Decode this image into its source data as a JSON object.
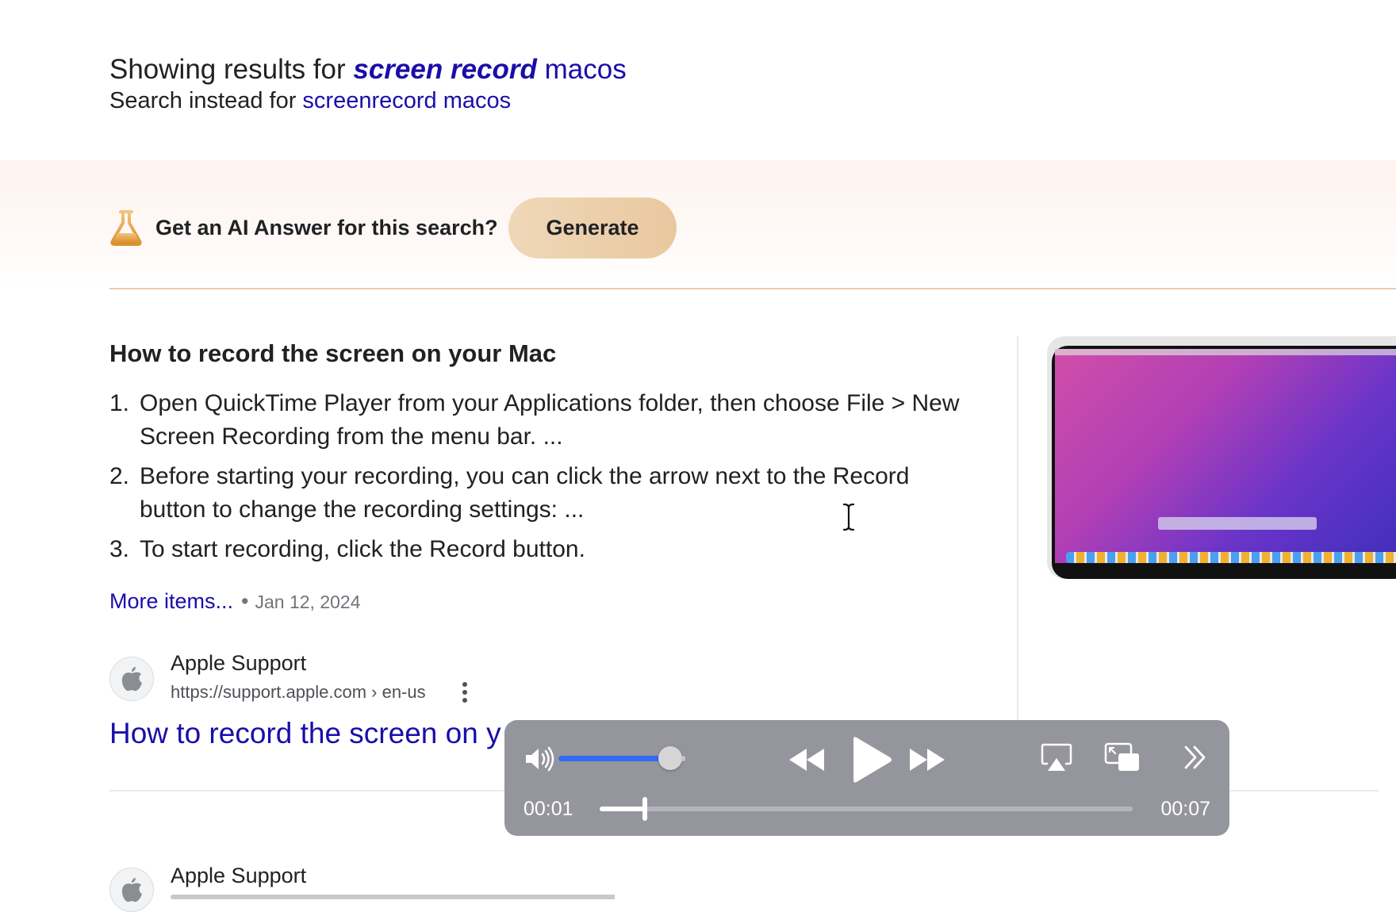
{
  "spelling": {
    "showing_prefix": "Showing results for",
    "corrected_bold": "screen record",
    "corrected_rest": "macos",
    "instead_prefix": "Search instead for",
    "instead_query": "screenrecord macos"
  },
  "ai_prompt": {
    "text": "Get an AI Answer for this search?",
    "button": "Generate",
    "icon": "flask-icon",
    "accent_color": "#e9c89f"
  },
  "snippet": {
    "title": "How to record the screen on your Mac",
    "steps": [
      {
        "num": "1.",
        "text": "Open QuickTime Player from your Applications folder, then choose File > New Screen Recording from the menu bar. ..."
      },
      {
        "num": "2.",
        "text": "Before starting your recording, you can click the arrow next to the Record button to change the recording settings: ..."
      },
      {
        "num": "3.",
        "text": "To start recording, click the Record button."
      }
    ],
    "more_link": "More items...",
    "separator": "•",
    "date": "Jan 12, 2024"
  },
  "results": [
    {
      "source": "Apple Support",
      "url": "https://support.apple.com › en-us",
      "title": "How to record the screen on y"
    },
    {
      "source": "Apple Support"
    }
  ],
  "media_hud": {
    "current_time": "00:01",
    "total_time": "00:07",
    "progress": 0.085,
    "volume": 0.88,
    "icons": [
      "speaker-icon",
      "rewind-icon",
      "play-icon",
      "fast-forward-icon",
      "airplay-icon",
      "picture-in-picture-icon",
      "chevron-double-right-icon"
    ]
  }
}
